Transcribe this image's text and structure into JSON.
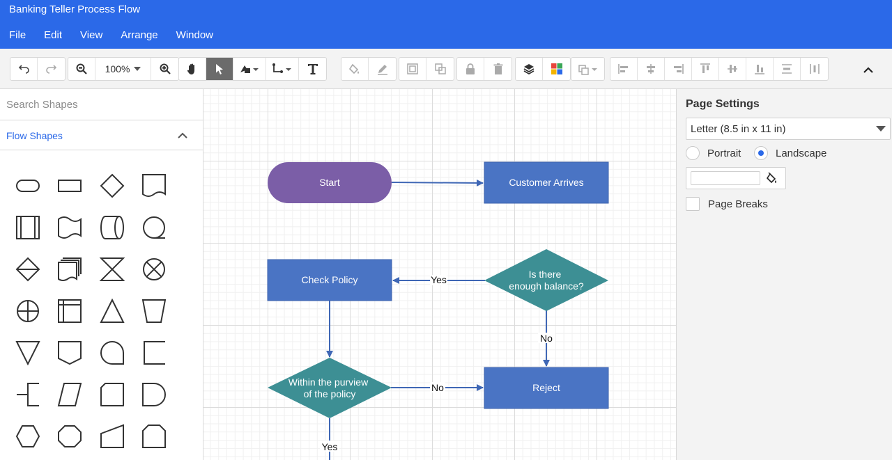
{
  "window": {
    "title": "Banking Teller Process Flow"
  },
  "menu": [
    "File",
    "Edit",
    "View",
    "Arrange",
    "Window"
  ],
  "toolbar": {
    "zoom_level": "100%"
  },
  "left_panel": {
    "search_placeholder": "Search Shapes",
    "section_title": "Flow Shapes"
  },
  "right_panel": {
    "title": "Page Settings",
    "paper_size": "Letter (8.5 in x 11 in)",
    "orientation_portrait": "Portrait",
    "orientation_landscape": "Landscape",
    "selected_orientation": "Landscape",
    "page_breaks_label": "Page Breaks"
  },
  "diagram": {
    "nodes": {
      "start": "Start",
      "customer_arrives": "Customer Arrives",
      "balance_q1": "Is there",
      "balance_q2": "enough balance?",
      "check_policy": "Check Policy",
      "purview_1": "Within the purview",
      "purview_2": "of the policy",
      "reject": "Reject"
    },
    "edges": {
      "yes_1": "Yes",
      "no_1": "No",
      "no_2": "No",
      "yes_2": "Yes"
    },
    "colors": {
      "terminal": "#7b5ea7",
      "process": "#4a74c4",
      "decision": "#3d8f94",
      "connector": "#3f67b5"
    }
  }
}
